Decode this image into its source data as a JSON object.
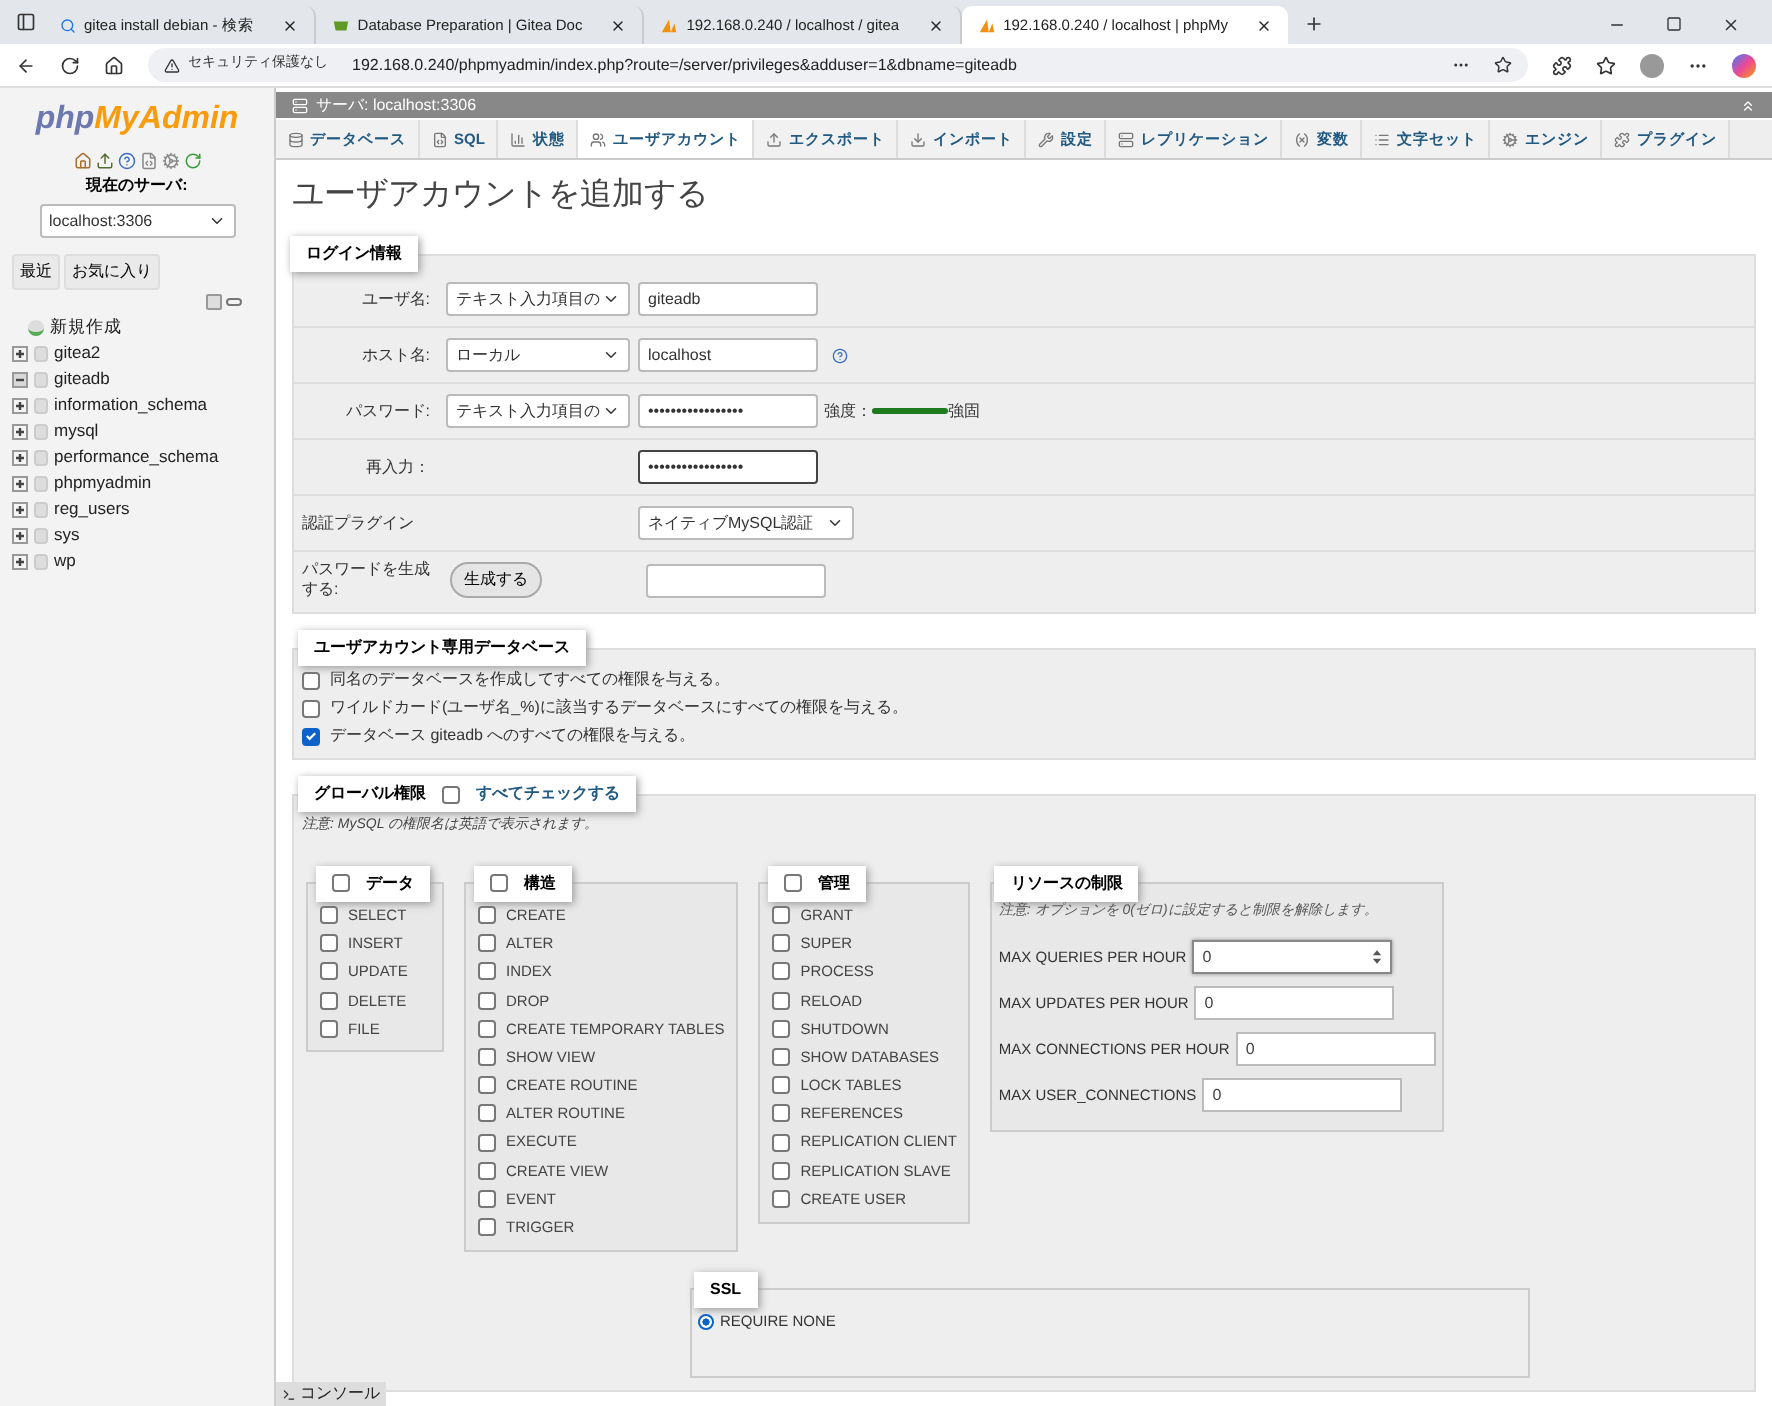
{
  "browser": {
    "tabs": [
      {
        "title": "gitea install debian - 検索",
        "selected": false,
        "kind": "search"
      },
      {
        "title": "Database Preparation | Gitea Doc",
        "selected": false,
        "kind": "gitea"
      },
      {
        "title": "192.168.0.240 / localhost / gitea",
        "selected": false,
        "kind": "pma"
      },
      {
        "title": "192.168.0.240 / localhost | phpMy",
        "selected": true,
        "kind": "pma"
      }
    ],
    "security": "セキュリティ保護なし",
    "url": "192.168.0.240/phpmyadmin/index.php?route=/server/privileges&adduser=1&dbname=giteadb"
  },
  "sidebar": {
    "logo": {
      "part_1": "php",
      "part_2": "MyAdmin"
    },
    "server_label": "現在のサーバ:",
    "server_select": "localhost:3306",
    "buttons": [
      "最近",
      "お気に入り"
    ],
    "tree": [
      {
        "label": "新規作成",
        "kind": "new"
      },
      {
        "label": "gitea2",
        "kind": "db",
        "expanded": false
      },
      {
        "label": "giteadb",
        "kind": "db",
        "expanded": true
      },
      {
        "label": "information_schema",
        "kind": "db",
        "expanded": false
      },
      {
        "label": "mysql",
        "kind": "db",
        "expanded": false
      },
      {
        "label": "performance_schema",
        "kind": "db",
        "expanded": false
      },
      {
        "label": "phpmyadmin",
        "kind": "db",
        "expanded": false
      },
      {
        "label": "reg_users",
        "kind": "db",
        "expanded": false
      },
      {
        "label": "sys",
        "kind": "db",
        "expanded": false
      },
      {
        "label": "wp",
        "kind": "db",
        "expanded": false
      }
    ]
  },
  "breadcrumb": "サーバ: localhost:3306",
  "tabs": [
    {
      "label": "データベース",
      "selected": false
    },
    {
      "label": "SQL",
      "selected": false
    },
    {
      "label": "状態",
      "selected": false
    },
    {
      "label": "ユーザアカウント",
      "selected": true
    },
    {
      "label": "エクスポート",
      "selected": false
    },
    {
      "label": "インポート",
      "selected": false
    },
    {
      "label": "設定",
      "selected": false
    },
    {
      "label": "レプリケーション",
      "selected": false
    },
    {
      "label": "変数",
      "selected": false
    },
    {
      "label": "文字セット",
      "selected": false
    },
    {
      "label": "エンジン",
      "selected": false
    },
    {
      "label": "プラグイン",
      "selected": false
    }
  ],
  "title": "ユーザアカウントを追加する",
  "login": {
    "legend": "ログイン情報",
    "rows": [
      {
        "kind": "select_input",
        "label": "ユーザ名:",
        "select": "テキスト入力項目の",
        "value": "giteadb"
      },
      {
        "kind": "select_input_help",
        "label": "ホスト名:",
        "select": "ローカル",
        "value": "localhost"
      },
      {
        "kind": "password",
        "label": "パスワード:",
        "select": "テキスト入力項目の",
        "value": "•••••••••••••••••",
        "strength_label": "強度：",
        "level": 1,
        "strength": "強固"
      },
      {
        "kind": "input",
        "label": "再入力：",
        "value": "•••••••••••••••••"
      },
      {
        "kind": "select",
        "label": "認証プラグイン",
        "select": "ネイティブMySQL認証"
      },
      {
        "kind": "generate",
        "label": "パスワードを生成する:",
        "button": "生成する"
      }
    ]
  },
  "user_db": {
    "legend": "ユーザアカウント専用データベース",
    "options": [
      {
        "label": "同名のデータベースを作成してすべての権限を与える。",
        "checked": false
      },
      {
        "label": "ワイルドカード(ユーザ名_%)に該当するデータベースにすべての権限を与える。",
        "checked": false
      },
      {
        "label": "データベース giteadb へのすべての権限を与える。",
        "checked": true
      }
    ]
  },
  "global": {
    "legend": "グローバル権限",
    "check_all": {
      "label": "すべてチェックする",
      "checked": false
    },
    "note": "注意: MySQL の権限名は英語で表示されます。",
    "groups": [
      {
        "legend": "データ",
        "checked": false,
        "items": [
          {
            "label": "SELECT",
            "checked": false
          },
          {
            "label": "INSERT",
            "checked": false
          },
          {
            "label": "UPDATE",
            "checked": false
          },
          {
            "label": "DELETE",
            "checked": false
          },
          {
            "label": "FILE",
            "checked": false
          }
        ]
      },
      {
        "legend": "構造",
        "checked": false,
        "items": [
          {
            "label": "CREATE",
            "checked": false
          },
          {
            "label": "ALTER",
            "checked": false
          },
          {
            "label": "INDEX",
            "checked": false
          },
          {
            "label": "DROP",
            "checked": false
          },
          {
            "label": "CREATE TEMPORARY TABLES",
            "checked": false
          },
          {
            "label": "SHOW VIEW",
            "checked": false
          },
          {
            "label": "CREATE ROUTINE",
            "checked": false
          },
          {
            "label": "ALTER ROUTINE",
            "checked": false
          },
          {
            "label": "EXECUTE",
            "checked": false
          },
          {
            "label": "CREATE VIEW",
            "checked": false
          },
          {
            "label": "EVENT",
            "checked": false
          },
          {
            "label": "TRIGGER",
            "checked": false
          }
        ]
      },
      {
        "legend": "管理",
        "checked": false,
        "items": [
          {
            "label": "GRANT",
            "checked": false
          },
          {
            "label": "SUPER",
            "checked": false
          },
          {
            "label": "PROCESS",
            "checked": false
          },
          {
            "label": "RELOAD",
            "checked": false
          },
          {
            "label": "SHUTDOWN",
            "checked": false
          },
          {
            "label": "SHOW DATABASES",
            "checked": false
          },
          {
            "label": "LOCK TABLES",
            "checked": false
          },
          {
            "label": "REFERENCES",
            "checked": false
          },
          {
            "label": "REPLICATION CLIENT",
            "checked": false
          },
          {
            "label": "REPLICATION SLAVE",
            "checked": false
          },
          {
            "label": "CREATE USER",
            "checked": false
          }
        ]
      }
    ],
    "resources": {
      "legend": "リソースの制限",
      "note": "注意: オプションを 0(ゼロ)に設定すると制限を解除します。",
      "fields": [
        {
          "kind": "spinner",
          "label": "MAX QUERIES PER HOUR",
          "value": "0"
        },
        {
          "kind": "text",
          "label": "MAX UPDATES PER HOUR",
          "value": "0"
        },
        {
          "kind": "text",
          "label": "MAX CONNECTIONS PER HOUR",
          "value": "0"
        },
        {
          "kind": "text",
          "label": "MAX USER_CONNECTIONS",
          "value": "0"
        }
      ]
    },
    "ssl": {
      "legend": "SSL",
      "options": [
        {
          "label": "REQUIRE NONE",
          "selected": true
        }
      ]
    }
  },
  "console": "コンソール"
}
